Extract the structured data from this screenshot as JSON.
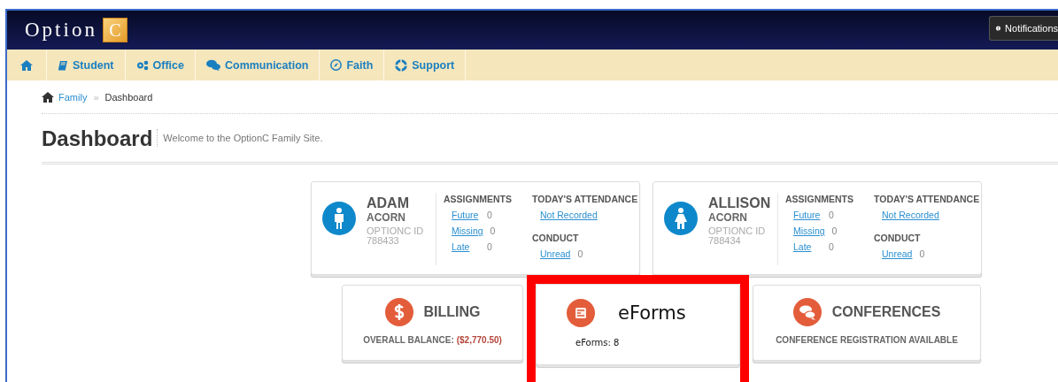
{
  "header": {
    "logo_text": "Option",
    "logo_letter": "C",
    "notifications_button": "Notifications"
  },
  "nav": [
    {
      "kind": "home"
    },
    {
      "label": "Student",
      "kind": "book"
    },
    {
      "label": "Office",
      "kind": "gears"
    },
    {
      "label": "Communication",
      "kind": "chat"
    },
    {
      "label": "Faith",
      "kind": "compass"
    },
    {
      "label": "Support",
      "kind": "lifebuoy"
    }
  ],
  "breadcrumb": [
    {
      "label": "Family",
      "kind": "link"
    },
    {
      "label": "»",
      "kind": "separator"
    },
    {
      "label": "Dashboard",
      "kind": "current"
    }
  ],
  "page": {
    "title": "Dashboard",
    "subtitle": "Welcome to the OptionC Family Site."
  },
  "students": [
    {
      "first_name": "ADAM",
      "last_name": "ACORN",
      "id_label": "OPTIONC ID",
      "id": "788433",
      "kind": "boy",
      "assignments_heading": "ASSIGNMENTS",
      "assignments": [
        {
          "label": "Future",
          "count": "0"
        },
        {
          "label": "Missing",
          "count": "0"
        },
        {
          "label": "Late",
          "count": "0"
        }
      ],
      "attendance_heading": "TODAY'S ATTENDANCE",
      "attendance": "Not Recorded",
      "conduct_heading": "CONDUCT",
      "conduct": {
        "label": "Unread",
        "count": "0"
      }
    },
    {
      "first_name": "ALLISON",
      "last_name": "ACORN",
      "id_label": "OPTIONC ID",
      "id": "788434",
      "kind": "girl",
      "assignments_heading": "ASSIGNMENTS",
      "assignments": [
        {
          "label": "Future",
          "count": "0"
        },
        {
          "label": "Missing",
          "count": "0"
        },
        {
          "label": "Late",
          "count": "0"
        }
      ],
      "attendance_heading": "TODAY'S ATTENDANCE",
      "attendance": "Not Recorded",
      "conduct_heading": "CONDUCT",
      "conduct": {
        "label": "Unread",
        "count": "0"
      }
    }
  ],
  "tiles": [
    {
      "kind": "billing",
      "title": "BILLING",
      "detail_label": "OVERALL BALANCE:",
      "detail_value": "($2,770.50)",
      "highlighted": false
    },
    {
      "kind": "eforms",
      "title": "eForms",
      "detail_label": "eForms: 8",
      "highlighted": true
    },
    {
      "kind": "conferences",
      "title": "CONFERENCES",
      "detail_label": "CONFERENCE REGISTRATION AVAILABLE",
      "highlighted": false
    }
  ]
}
